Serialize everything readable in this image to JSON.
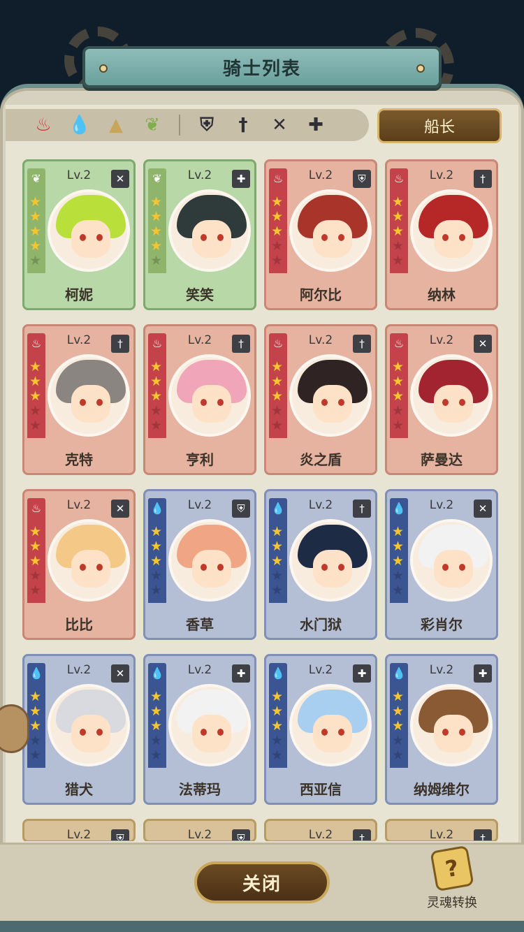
{
  "title": "骑士列表",
  "captain_label": "船长",
  "close_label": "关闭",
  "soul_label": "灵魂转换",
  "soul_icon_glyph": "?",
  "filters": [
    {
      "name": "fire-filter-icon",
      "glyph": "♨",
      "color": "#c9343d"
    },
    {
      "name": "water-filter-icon",
      "glyph": "💧",
      "color": "#2c63c6"
    },
    {
      "name": "earth-filter-icon",
      "glyph": "▲",
      "color": "#c8a55a"
    },
    {
      "name": "wind-filter-icon",
      "glyph": "❦",
      "color": "#7fae4a"
    },
    {
      "name": "defense-class-filter-icon",
      "glyph": "⛨",
      "color": "#2f2f36"
    },
    {
      "name": "sword-class-filter-icon",
      "glyph": "†",
      "color": "#2f2f36"
    },
    {
      "name": "ranged-class-filter-icon",
      "glyph": "✕",
      "color": "#2f2f36"
    },
    {
      "name": "support-class-filter-icon",
      "glyph": "✚",
      "color": "#2f2f36"
    }
  ],
  "knights": [
    {
      "name": "柯妮",
      "level": "Lv.2",
      "element": "wind",
      "stars": 4,
      "class_glyph": "✕",
      "hair": "#b9e03a"
    },
    {
      "name": "笑笑",
      "level": "Lv.2",
      "element": "wind",
      "stars": 4,
      "class_glyph": "✚",
      "hair": "#2e3b3a"
    },
    {
      "name": "阿尔比",
      "level": "Lv.2",
      "element": "fire",
      "stars": 3,
      "class_glyph": "⛨",
      "hair": "#a8342a"
    },
    {
      "name": "纳林",
      "level": "Lv.2",
      "element": "fire",
      "stars": 3,
      "class_glyph": "†",
      "hair": "#b62828"
    },
    {
      "name": "克特",
      "level": "Lv.2",
      "element": "fire",
      "stars": 3,
      "class_glyph": "†",
      "hair": "#8a8580"
    },
    {
      "name": "亨利",
      "level": "Lv.2",
      "element": "fire",
      "stars": 3,
      "class_glyph": "†",
      "hair": "#f0a6b8"
    },
    {
      "name": "炎之盾",
      "level": "Lv.2",
      "element": "fire",
      "stars": 3,
      "class_glyph": "†",
      "hair": "#2f2323"
    },
    {
      "name": "萨曼达",
      "level": "Lv.2",
      "element": "fire",
      "stars": 3,
      "class_glyph": "✕",
      "hair": "#a32431"
    },
    {
      "name": "比比",
      "level": "Lv.2",
      "element": "fire",
      "stars": 3,
      "class_glyph": "✕",
      "hair": "#f4c987"
    },
    {
      "name": "香草",
      "level": "Lv.2",
      "element": "water",
      "stars": 3,
      "class_glyph": "⛨",
      "hair": "#f0a585"
    },
    {
      "name": "水门狱",
      "level": "Lv.2",
      "element": "water",
      "stars": 3,
      "class_glyph": "†",
      "hair": "#1d2b44"
    },
    {
      "name": "彩肖尔",
      "level": "Lv.2",
      "element": "water",
      "stars": 3,
      "class_glyph": "✕",
      "hair": "#f2f2f2"
    },
    {
      "name": "猎犬",
      "level": "Lv.2",
      "element": "water",
      "stars": 3,
      "class_glyph": "✕",
      "hair": "#d9d9e0"
    },
    {
      "name": "法蒂玛",
      "level": "Lv.2",
      "element": "water",
      "stars": 3,
      "class_glyph": "✚",
      "hair": "#f2f2f2"
    },
    {
      "name": "西亚信",
      "level": "Lv.2",
      "element": "water",
      "stars": 3,
      "class_glyph": "✚",
      "hair": "#a9cff0"
    },
    {
      "name": "纳姆维尔",
      "level": "Lv.2",
      "element": "water",
      "stars": 3,
      "class_glyph": "✚",
      "hair": "#8a5a35"
    }
  ],
  "partial_row": [
    {
      "level": "Lv.2",
      "element": "earth",
      "class_glyph": "⛨"
    },
    {
      "level": "Lv.2",
      "element": "earth",
      "class_glyph": "⛨"
    },
    {
      "level": "Lv.2",
      "element": "earth",
      "class_glyph": "†"
    },
    {
      "level": "Lv.2",
      "element": "earth",
      "class_glyph": "†"
    }
  ],
  "element_glyphs": {
    "fire": "♨",
    "water": "💧",
    "wind": "❦",
    "earth": "▲"
  },
  "element_colors": {
    "fire": "red",
    "water": "blue",
    "wind": "green",
    "earth": "red"
  }
}
